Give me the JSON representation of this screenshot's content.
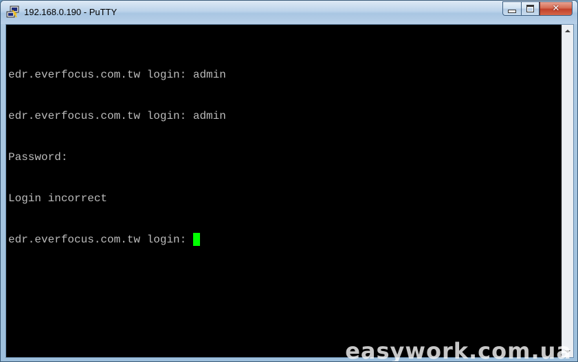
{
  "window": {
    "title": "192.168.0.190 - PuTTY",
    "icon": "putty-icon",
    "controls": {
      "minimize": "minimize-icon",
      "maximize": "maximize-icon",
      "close": "close-icon"
    }
  },
  "terminal": {
    "background": "#000000",
    "foreground": "#bbbbbb",
    "cursor_color": "#00ff00",
    "lines": [
      "edr.everfocus.com.tw login: admin",
      "edr.everfocus.com.tw login: admin",
      "Password:",
      "Login incorrect",
      "edr.everfocus.com.tw login: "
    ]
  },
  "watermark": "easywork.com.ua",
  "colors": {
    "title_bar": "#b8d0e8",
    "close_button": "#c1412a"
  }
}
